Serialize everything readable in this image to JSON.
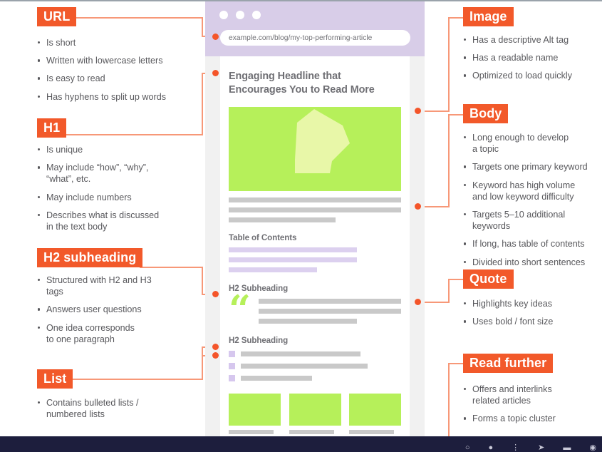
{
  "theme": {
    "accent": "#f2592a",
    "connector": "#f79878",
    "dot": "#f4552a",
    "lavender": "#d8cde8",
    "green": "#b6f05a",
    "gray_bar": "#c9c9c9",
    "footer_bg": "#1d1e3d",
    "text": "#58585c"
  },
  "left_sections": [
    {
      "label": "URL",
      "items": [
        "Is short",
        "Written with lowercase letters",
        "Is easy to read",
        "Has hyphens to split up words"
      ]
    },
    {
      "label": "H1",
      "items": [
        "Is unique",
        "May include “how”, “why”,\n“what”, etc.",
        "May include numbers",
        "Describes what is discussed\nin the text body"
      ]
    },
    {
      "label": "H2 subheading",
      "items": [
        "Structured with H2 and H3\ntags",
        "Answers user questions",
        "One idea corresponds\nto one paragraph"
      ]
    },
    {
      "label": "List",
      "items": [
        "Contains bulleted lists /\nnumbered lists"
      ]
    }
  ],
  "right_sections": [
    {
      "label": "Image",
      "items": [
        "Has a descriptive Alt tag",
        "Has a readable name",
        "Optimized to load quickly"
      ]
    },
    {
      "label": "Body",
      "items": [
        "Long enough to develop\na topic",
        "Targets one primary keyword",
        "Keyword has high volume\nand low keyword difficulty",
        "Targets 5–10 additional keywords",
        "If long, has table of contents",
        "Divided into short sentences"
      ]
    },
    {
      "label": "Quote",
      "items": [
        "Highlights key ideas",
        "Uses bold / font size"
      ]
    },
    {
      "label": "Read further",
      "items": [
        "Offers and interlinks\nrelated articles",
        "Forms a topic cluster"
      ]
    }
  ],
  "browser": {
    "url": "example.com/blog/my-top-performing-article",
    "window_dots": [
      "dot-1",
      "dot-2",
      "dot-3"
    ],
    "page": {
      "headline": "Engaging Headline that\nEncourages You to Read More",
      "hero_image_alt": "hero-placeholder-shape",
      "toc_title": "Table of Contents",
      "subheading_1": "H2 Subheading",
      "subheading_2": "H2 Subheading",
      "quote_glyph": "“"
    }
  },
  "footer": {
    "icons": [
      "chat-icon",
      "user-icon",
      "link-icon",
      "cursor-icon",
      "card-icon",
      "globe-icon"
    ]
  }
}
